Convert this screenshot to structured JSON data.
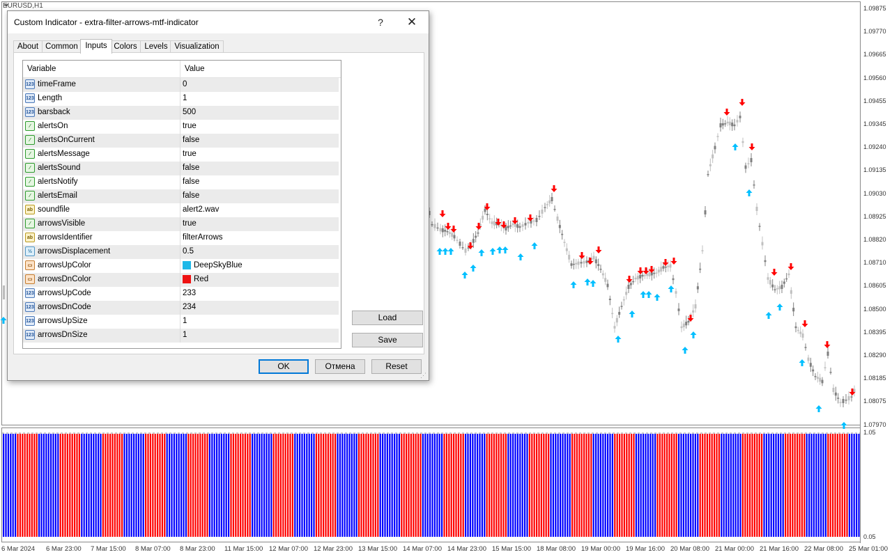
{
  "chart": {
    "symbol": "EURUSD,H1",
    "price_ticks": [
      "1.09875",
      "1.09770",
      "1.09665",
      "1.09560",
      "1.09455",
      "1.09345",
      "1.09240",
      "1.09135",
      "1.09030",
      "1.08925",
      "1.08820",
      "1.08710",
      "1.08605",
      "1.08500",
      "1.08395",
      "1.08290",
      "1.08185",
      "1.08075",
      "1.07970"
    ],
    "sub_ticks": {
      "top": "1.05",
      "bottom": "0.05"
    },
    "time_ticks": [
      "6 Mar 2024",
      "6 Mar 23:00",
      "7 Mar 15:00",
      "8 Mar 07:00",
      "8 Mar 23:00",
      "11 Mar 15:00",
      "12 Mar 07:00",
      "12 Mar 23:00",
      "13 Mar 15:00",
      "14 Mar 07:00",
      "14 Mar 23:00",
      "15 Mar 15:00",
      "18 Mar 08:00",
      "19 Mar 00:00",
      "19 Mar 16:00",
      "20 Mar 08:00",
      "21 Mar 00:00",
      "21 Mar 16:00",
      "22 Mar 08:00",
      "25 Mar 01:00"
    ],
    "colors": {
      "up_arrow": "#00bfff",
      "down_arrow": "#ff0000",
      "hist_up": "#0000ff",
      "hist_dn": "#ff0000",
      "candle_bull": "#c0c0c0",
      "candle_bear": "#808080"
    }
  },
  "dialog": {
    "title": "Custom Indicator - extra-filter-arrows-mtf-indicator",
    "help_glyph": "?",
    "close_glyph": "✕",
    "tabs": [
      "About",
      "Common",
      "Inputs",
      "Colors",
      "Levels",
      "Visualization"
    ],
    "active_tab": "Inputs",
    "grid": {
      "col_variable": "Variable",
      "col_value": "Value",
      "rows": [
        {
          "type": "num",
          "icon": "123",
          "name": "timeFrame",
          "value": "0"
        },
        {
          "type": "num",
          "icon": "123",
          "name": "Length",
          "value": "1"
        },
        {
          "type": "num",
          "icon": "123",
          "name": "barsback",
          "value": "500"
        },
        {
          "type": "bool",
          "icon": "⁄",
          "name": "alertsOn",
          "value": "true"
        },
        {
          "type": "bool",
          "icon": "⁄",
          "name": "alertsOnCurrent",
          "value": "false"
        },
        {
          "type": "bool",
          "icon": "⁄",
          "name": "alertsMessage",
          "value": "true"
        },
        {
          "type": "bool",
          "icon": "⁄",
          "name": "alertsSound",
          "value": "false"
        },
        {
          "type": "bool",
          "icon": "⁄",
          "name": "alertsNotify",
          "value": "false"
        },
        {
          "type": "bool",
          "icon": "⁄",
          "name": "alertsEmail",
          "value": "false"
        },
        {
          "type": "str",
          "icon": "ab",
          "name": "soundfile",
          "value": "alert2.wav"
        },
        {
          "type": "bool",
          "icon": "⁄",
          "name": "arrowsVisible",
          "value": "true"
        },
        {
          "type": "str",
          "icon": "ab",
          "name": "arrowsIdentifier",
          "value": "filterArrows"
        },
        {
          "type": "dbl",
          "icon": "½",
          "name": "arrowsDisplacement",
          "value": "0.5"
        },
        {
          "type": "clr",
          "icon": "▭",
          "name": "arrowsUpColor",
          "value": "DeepSkyBlue",
          "swatch": "#1fb8e8"
        },
        {
          "type": "clr",
          "icon": "▭",
          "name": "arrowsDnColor",
          "value": "Red",
          "swatch": "#ee1111"
        },
        {
          "type": "num",
          "icon": "123",
          "name": "arrowsUpCode",
          "value": "233"
        },
        {
          "type": "num",
          "icon": "123",
          "name": "arrowsDnCode",
          "value": "234"
        },
        {
          "type": "num",
          "icon": "123",
          "name": "arrowsUpSize",
          "value": "1"
        },
        {
          "type": "num",
          "icon": "123",
          "name": "arrowsDnSize",
          "value": "1"
        }
      ]
    },
    "buttons": {
      "load": "Load",
      "save": "Save",
      "ok": "OK",
      "cancel": "Отмена",
      "reset": "Reset"
    }
  }
}
